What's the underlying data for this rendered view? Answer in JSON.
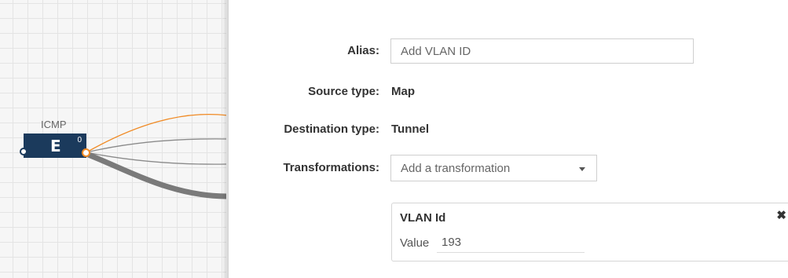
{
  "canvas": {
    "node": {
      "label": "ICMP",
      "icon": "filter-icon",
      "icon_glyph": "Ε",
      "port_count": "0"
    },
    "colors": {
      "node_fill": "#1b3a5c",
      "active_wire": "#f08a24",
      "inactive_wire": "#8a8a8a"
    }
  },
  "form": {
    "alias": {
      "label": "Alias:",
      "placeholder": "Add VLAN ID"
    },
    "source_type": {
      "label": "Source type:",
      "value": "Map"
    },
    "destination_type": {
      "label": "Destination type:",
      "value": "Tunnel"
    },
    "transformations": {
      "label": "Transformations:",
      "placeholder": "Add a transformation"
    },
    "transformation_card": {
      "title": "VLAN Id",
      "close_glyph": "✖",
      "value_label": "Value",
      "value": "193"
    }
  }
}
